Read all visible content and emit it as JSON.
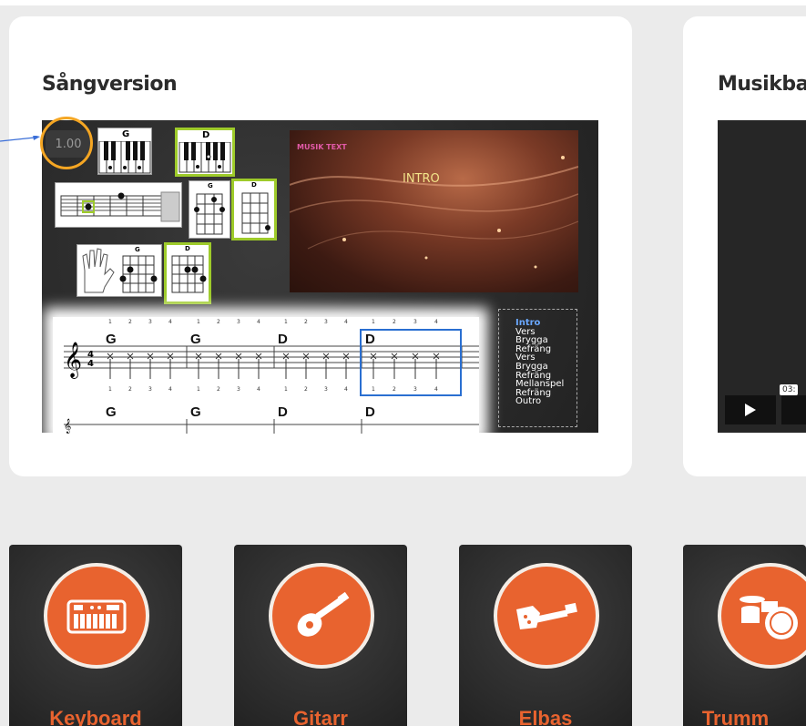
{
  "sang": {
    "title": "Sångversion",
    "speed": "1.00",
    "video_logo": "MUSIK TEXT",
    "video_text": "INTRO",
    "chords_row1": [
      "G",
      "G",
      "D",
      "D"
    ],
    "chords_row2": [
      "G",
      "G",
      "D",
      "D"
    ],
    "diagram_chords": {
      "piano1": "G",
      "piano2": "D",
      "uke1": "G",
      "uke2": "D",
      "hand1": "G",
      "hand2": "D"
    },
    "beats": [
      "1",
      "2",
      "3",
      "4"
    ],
    "sections": [
      "Intro",
      "Vers",
      "Brygga",
      "Refräng",
      "Vers",
      "Brygga",
      "Refräng",
      "Mellanspel",
      "Refräng",
      "Outro"
    ],
    "active_section": "Intro"
  },
  "musik": {
    "title": "Musikba",
    "time": "03:"
  },
  "instruments": [
    {
      "label": "Keyboard",
      "icon": "keyboard-icon"
    },
    {
      "label": "Gitarr",
      "icon": "guitar-icon"
    },
    {
      "label": "Elbas",
      "icon": "bass-icon"
    },
    {
      "label": "Trumm",
      "icon": "drums-icon"
    }
  ],
  "colors": {
    "accent": "#e8632f",
    "highlight": "#f5a623",
    "chord_frame": "#9ecb2a",
    "active_bar": "#2a6fd1"
  }
}
